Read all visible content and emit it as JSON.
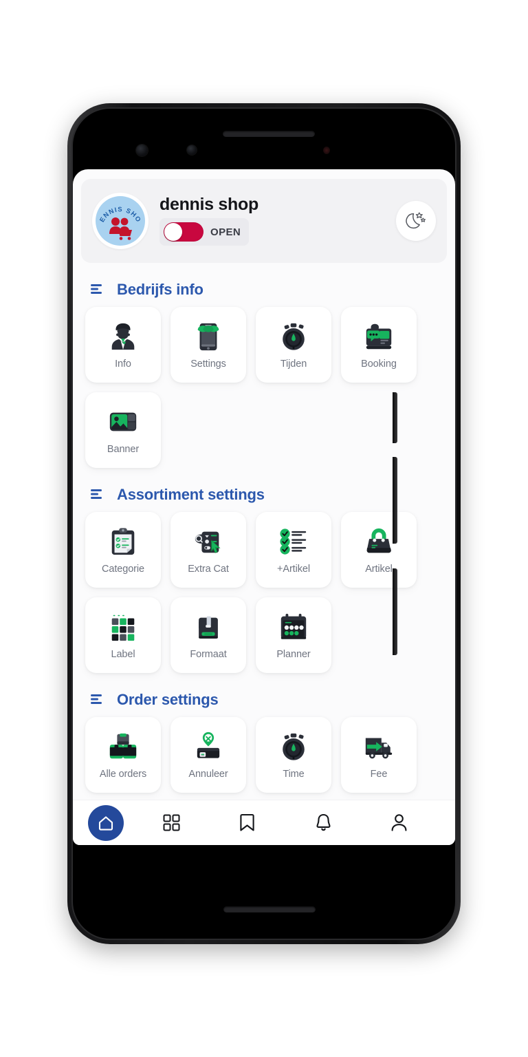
{
  "app": {
    "shop_name": "dennis shop",
    "logo_text": "DENNIS SHOP",
    "status_label": "OPEN",
    "status_color": "#c8073f",
    "accent_blue": "#2c58ad",
    "nav_active_color": "#24499b",
    "icon_green": "#17b45e",
    "icon_dark": "#2b2f38"
  },
  "header": {
    "night_mode_icon": "moon-stars-icon",
    "toggle_icon": "toggle-switch-on",
    "logo_icon": "shop-logo-icon"
  },
  "sections": [
    {
      "id": "bedrijfs-info",
      "title": "Bedrijfs info",
      "icon": "list-lines-icon",
      "tiles": [
        {
          "label": "Info",
          "icon": "person-suit-icon"
        },
        {
          "label": "Settings",
          "icon": "storefront-icon"
        },
        {
          "label": "Tijden",
          "icon": "stopwatch-icon"
        },
        {
          "label": "Booking",
          "icon": "chat-booking-icon"
        },
        {
          "label": "Banner",
          "icon": "image-placeholder-icon"
        }
      ]
    },
    {
      "id": "assortiment-settings",
      "title": "Assortiment settings",
      "icon": "list-lines-icon",
      "tiles": [
        {
          "label": "Categorie",
          "icon": "clipboard-checklist-icon"
        },
        {
          "label": "Extra Cat",
          "icon": "search-list-cursor-icon"
        },
        {
          "label": "+Artikel",
          "icon": "checklist-lines-icon"
        },
        {
          "label": "Artikel",
          "icon": "shopping-bag-icon"
        },
        {
          "label": "Label",
          "icon": "grid-squares-icon"
        },
        {
          "label": "Formaat",
          "icon": "package-box-icon"
        },
        {
          "label": "Planner",
          "icon": "calendar-icon"
        }
      ]
    },
    {
      "id": "order-settings",
      "title": "Order settings",
      "icon": "list-lines-icon",
      "tiles": [
        {
          "label": "Alle orders",
          "icon": "boxes-stack-icon"
        },
        {
          "label": "Annuleer",
          "icon": "box-cancel-pin-icon"
        },
        {
          "label": "Time",
          "icon": "stopwatch-icon"
        },
        {
          "label": "Fee",
          "icon": "delivery-truck-arrow-icon"
        }
      ]
    }
  ],
  "bottom_nav": [
    {
      "id": "home",
      "icon": "home-icon",
      "active": true
    },
    {
      "id": "apps",
      "icon": "grid-icon",
      "active": false
    },
    {
      "id": "bookmarks",
      "icon": "bookmark-icon",
      "active": false
    },
    {
      "id": "notifications",
      "icon": "bell-icon",
      "active": false
    },
    {
      "id": "profile",
      "icon": "person-icon",
      "active": false
    }
  ]
}
